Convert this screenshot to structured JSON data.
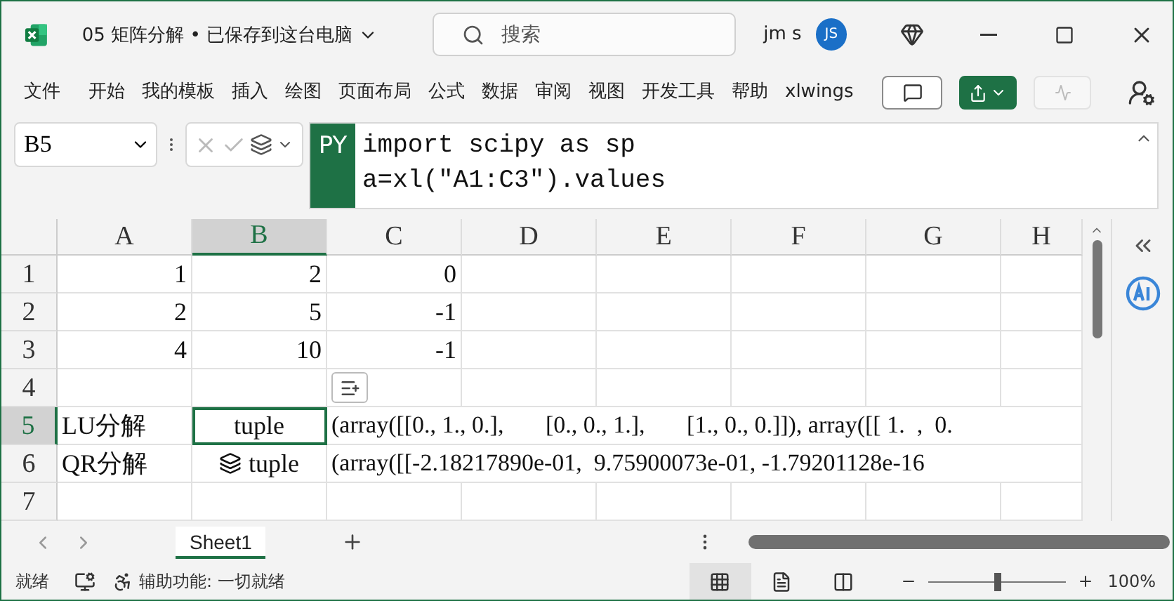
{
  "window": {
    "title": "05 矩阵分解 • 已保存到这台电脑",
    "search_placeholder": "搜索",
    "user": "jm s",
    "avatar": "JS"
  },
  "ribbon_tabs": [
    {
      "label": "文件",
      "selected": false
    },
    {
      "label": "开始",
      "selected": false
    },
    {
      "label": "我的模板",
      "selected": false
    },
    {
      "label": "插入",
      "selected": false
    },
    {
      "label": "绘图",
      "selected": false
    },
    {
      "label": "页面布局",
      "selected": false
    },
    {
      "label": "公式",
      "selected": false
    },
    {
      "label": "数据",
      "selected": false
    },
    {
      "label": "审阅",
      "selected": false
    },
    {
      "label": "视图",
      "selected": false
    },
    {
      "label": "开发工具",
      "selected": false
    },
    {
      "label": "帮助",
      "selected": false
    },
    {
      "label": "xlwings",
      "selected": false
    }
  ],
  "formula_bar": {
    "name_box": "B5",
    "tag": "PY",
    "lines": [
      "import scipy as sp",
      "a=xl(\"A1:C3\").values"
    ]
  },
  "columns": [
    {
      "label": "A",
      "selected": false
    },
    {
      "label": "B",
      "selected": true
    },
    {
      "label": "C",
      "selected": false
    },
    {
      "label": "D",
      "selected": false
    },
    {
      "label": "E",
      "selected": false
    },
    {
      "label": "F",
      "selected": false
    },
    {
      "label": "G",
      "selected": false
    },
    {
      "label": "H",
      "selected": false
    }
  ],
  "rows": [
    {
      "label": "1",
      "selected": false,
      "cells": [
        {
          "kind": "number",
          "text": "1"
        },
        {
          "kind": "number",
          "text": "2"
        },
        {
          "kind": "number",
          "text": "0"
        }
      ]
    },
    {
      "label": "2",
      "selected": false,
      "cells": [
        {
          "kind": "number",
          "text": "2"
        },
        {
          "kind": "number",
          "text": "5"
        },
        {
          "kind": "number",
          "text": "-1"
        }
      ]
    },
    {
      "label": "3",
      "selected": false,
      "cells": [
        {
          "kind": "number",
          "text": "4"
        },
        {
          "kind": "number",
          "text": "10"
        },
        {
          "kind": "number",
          "text": "-1"
        }
      ]
    },
    {
      "label": "4",
      "selected": false,
      "cells": []
    },
    {
      "label": "5",
      "selected": true,
      "cells": [
        {
          "kind": "text",
          "text": "LU分解"
        },
        {
          "kind": "python",
          "text": "tuple",
          "selected": true,
          "icon": false
        },
        {
          "kind": "overflow",
          "text": "(array([[0., 1., 0.],       [0., 0., 1.],       [1., 0., 0.]]), array([[ 1.  ,  0."
        }
      ]
    },
    {
      "label": "6",
      "selected": false,
      "cells": [
        {
          "kind": "text",
          "text": "QR分解"
        },
        {
          "kind": "python",
          "text": "tuple",
          "selected": false,
          "icon": true
        },
        {
          "kind": "overflow",
          "text": "(array([[-2.18217890e-01,  9.75900073e-01, -1.79201128e-16"
        }
      ]
    },
    {
      "label": "7",
      "selected": false,
      "cells": []
    }
  ],
  "sheet_tabs": [
    {
      "label": "Sheet1",
      "selected": true
    }
  ],
  "status_bar": {
    "ready": "就绪",
    "accessibility": "辅助功能: 一切就绪",
    "zoom": "100%",
    "zoom_slider": {
      "level": 0.5
    }
  }
}
